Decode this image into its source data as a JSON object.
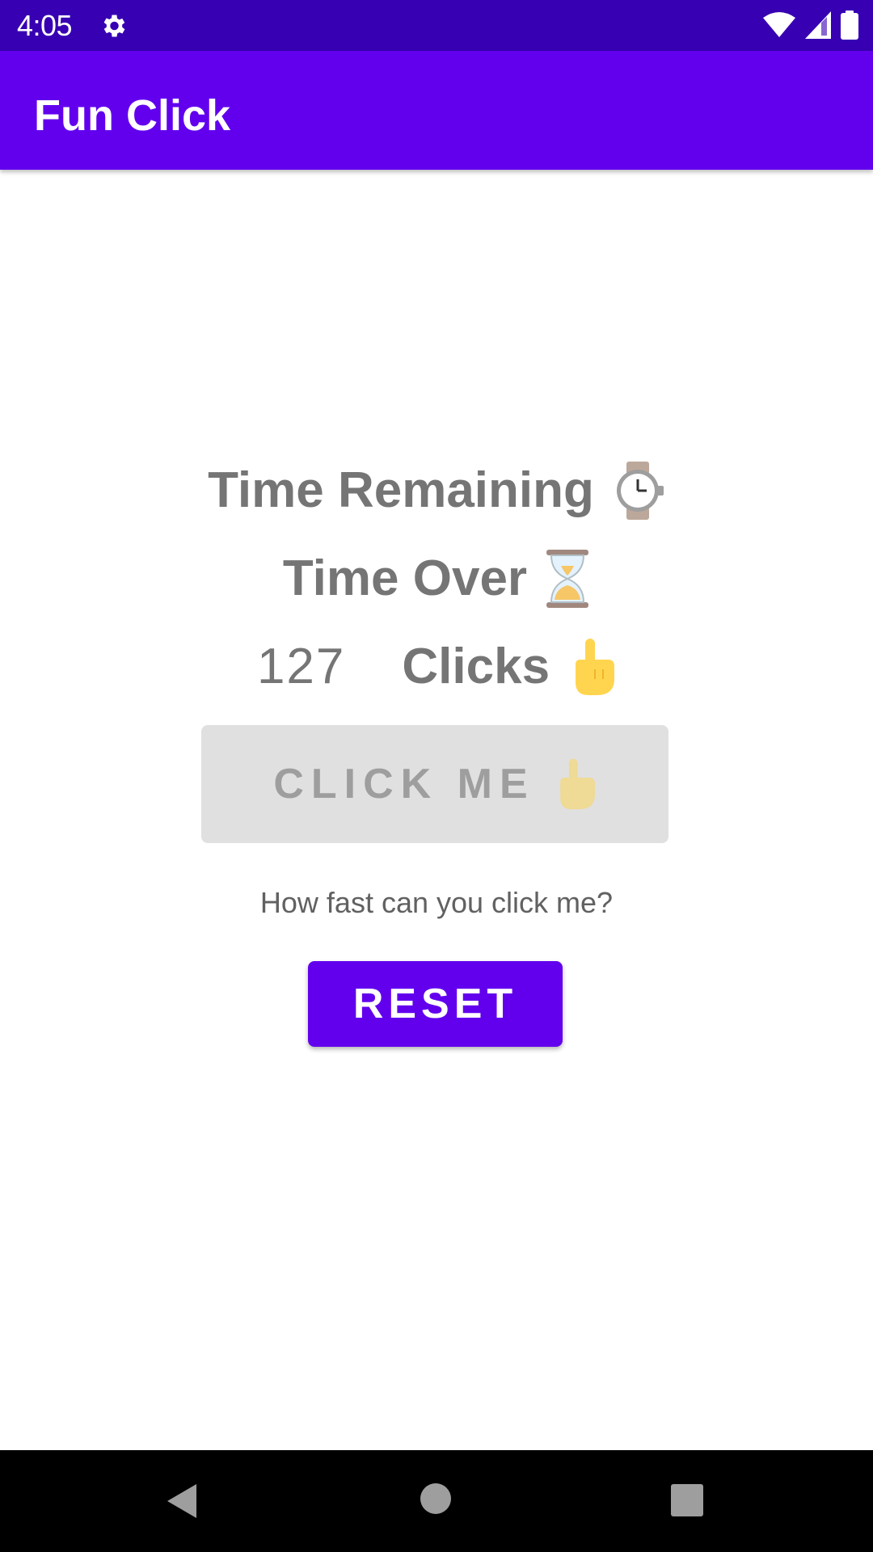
{
  "status_bar": {
    "time": "4:05",
    "icons": [
      "settings-gear-icon",
      "wifi-icon",
      "cell-signal-icon",
      "battery-icon"
    ],
    "background": "#3700b3"
  },
  "app_bar": {
    "title": "Fun Click",
    "background": "#6200ee"
  },
  "main": {
    "time_remaining_label": "Time Remaining",
    "time_over_label": "Time Over",
    "click_count": "127",
    "clicks_label": "Clicks",
    "click_button_label": "CLICK ME",
    "click_button_state": "disabled",
    "hint_text": "How fast can you click me?",
    "reset_button_label": "RESET",
    "emojis": [
      "watch-icon",
      "hourglass-icon",
      "pointing-hand-icon"
    ]
  },
  "nav_bar": {
    "buttons": [
      "back-button",
      "home-button",
      "recents-button"
    ]
  },
  "colors": {
    "accent": "#6200ee",
    "text_gray": "#757575",
    "disabled_bg": "#e0e0e0"
  }
}
